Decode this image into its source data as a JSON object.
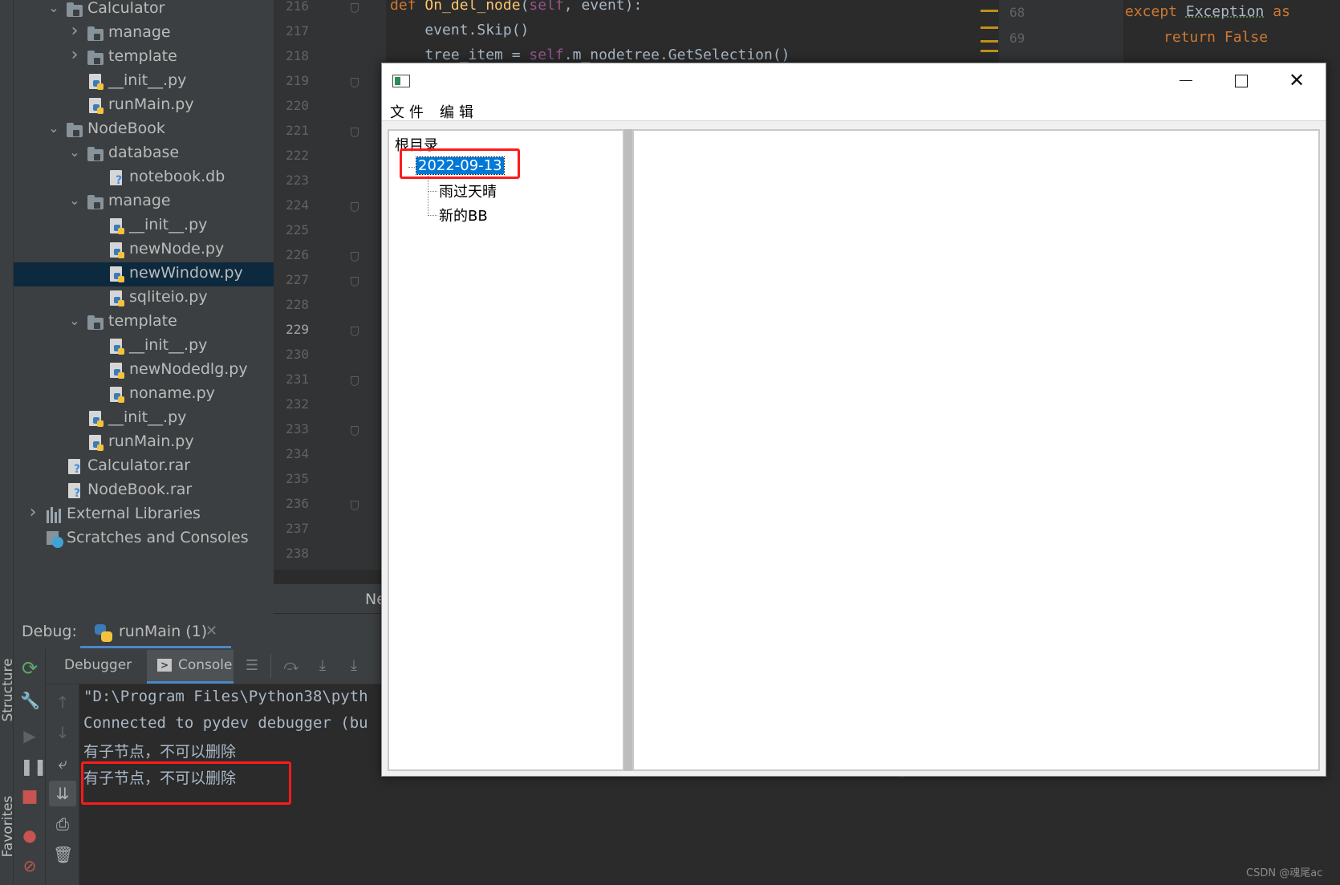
{
  "sidebar_tabs": {
    "structure": "Structure",
    "favorites": "Favorites"
  },
  "project_tree": [
    {
      "label": "Calculator",
      "depth": 1,
      "type": "folder",
      "expanded": true
    },
    {
      "label": "manage",
      "depth": 2,
      "type": "folder",
      "expanded": false
    },
    {
      "label": "template",
      "depth": 2,
      "type": "folder",
      "expanded": false
    },
    {
      "label": "__init__.py",
      "depth": 2,
      "type": "py"
    },
    {
      "label": "runMain.py",
      "depth": 2,
      "type": "py"
    },
    {
      "label": "NodeBook",
      "depth": 1,
      "type": "folder",
      "expanded": true
    },
    {
      "label": "database",
      "depth": 2,
      "type": "folder",
      "expanded": true
    },
    {
      "label": "notebook.db",
      "depth": 3,
      "type": "unknown"
    },
    {
      "label": "manage",
      "depth": 2,
      "type": "folder",
      "expanded": true
    },
    {
      "label": "__init__.py",
      "depth": 3,
      "type": "py"
    },
    {
      "label": "newNode.py",
      "depth": 3,
      "type": "py"
    },
    {
      "label": "newWindow.py",
      "depth": 3,
      "type": "py",
      "selected": true
    },
    {
      "label": "sqliteio.py",
      "depth": 3,
      "type": "py"
    },
    {
      "label": "template",
      "depth": 2,
      "type": "folder",
      "expanded": true
    },
    {
      "label": "__init__.py",
      "depth": 3,
      "type": "py"
    },
    {
      "label": "newNodedlg.py",
      "depth": 3,
      "type": "py"
    },
    {
      "label": "noname.py",
      "depth": 3,
      "type": "py"
    },
    {
      "label": "__init__.py",
      "depth": 2,
      "type": "py"
    },
    {
      "label": "runMain.py",
      "depth": 2,
      "type": "py"
    },
    {
      "label": "Calculator.rar",
      "depth": 1,
      "type": "unknown"
    },
    {
      "label": "NodeBook.rar",
      "depth": 1,
      "type": "unknown"
    },
    {
      "label": "External Libraries",
      "depth": 0,
      "type": "library",
      "expanded": false
    },
    {
      "label": "Scratches and Consoles",
      "depth": 0,
      "type": "scratch"
    }
  ],
  "editor": {
    "line_numbers": [
      "216",
      "217",
      "218",
      "219",
      "220",
      "221",
      "222",
      "223",
      "224",
      "225",
      "226",
      "227",
      "228",
      "229",
      "230",
      "231",
      "232",
      "233",
      "234",
      "235",
      "236",
      "237",
      "238"
    ],
    "current_line": "229",
    "code": {
      "l1_def": "def ",
      "l1_name": "On_del_node",
      "l1_paren": "(",
      "l1_self": "self",
      "l1_rest": ", event):",
      "l2": "    event.Skip()",
      "l3_a": "    tree_item = ",
      "l3_self": "self",
      "l3_b": ".m_nodetree.GetSelection()"
    },
    "bottom_tab_label": "Ne"
  },
  "right_editor": {
    "line_numbers": [
      "68",
      "69"
    ],
    "line1_kw": "except ",
    "line1_ex": "Exception",
    "line1_as": " as",
    "line2_kw": "return ",
    "line2_val": "False"
  },
  "debug": {
    "label": "Debug:",
    "run_tab": "runMain (1)",
    "tabs": {
      "debugger": "Debugger",
      "console": "Console"
    },
    "console_lines": [
      "\"D:\\Program Files\\Python38\\pyth",
      "Connected to pydev debugger (bu",
      "有子节点，不可以删除",
      "有子节点，不可以删除"
    ]
  },
  "wx_window": {
    "menu": [
      "文件",
      "编辑"
    ],
    "tree": {
      "root": "根目录",
      "selected_node": "2022-09-13",
      "children": [
        "雨过天晴",
        "新的BB"
      ]
    }
  },
  "watermark": "CSDN @魂尾ac",
  "colors": {
    "highlight_box": "#ff1a1a",
    "selection": "#0078d7",
    "ide_bg": "#2b2b2b"
  }
}
